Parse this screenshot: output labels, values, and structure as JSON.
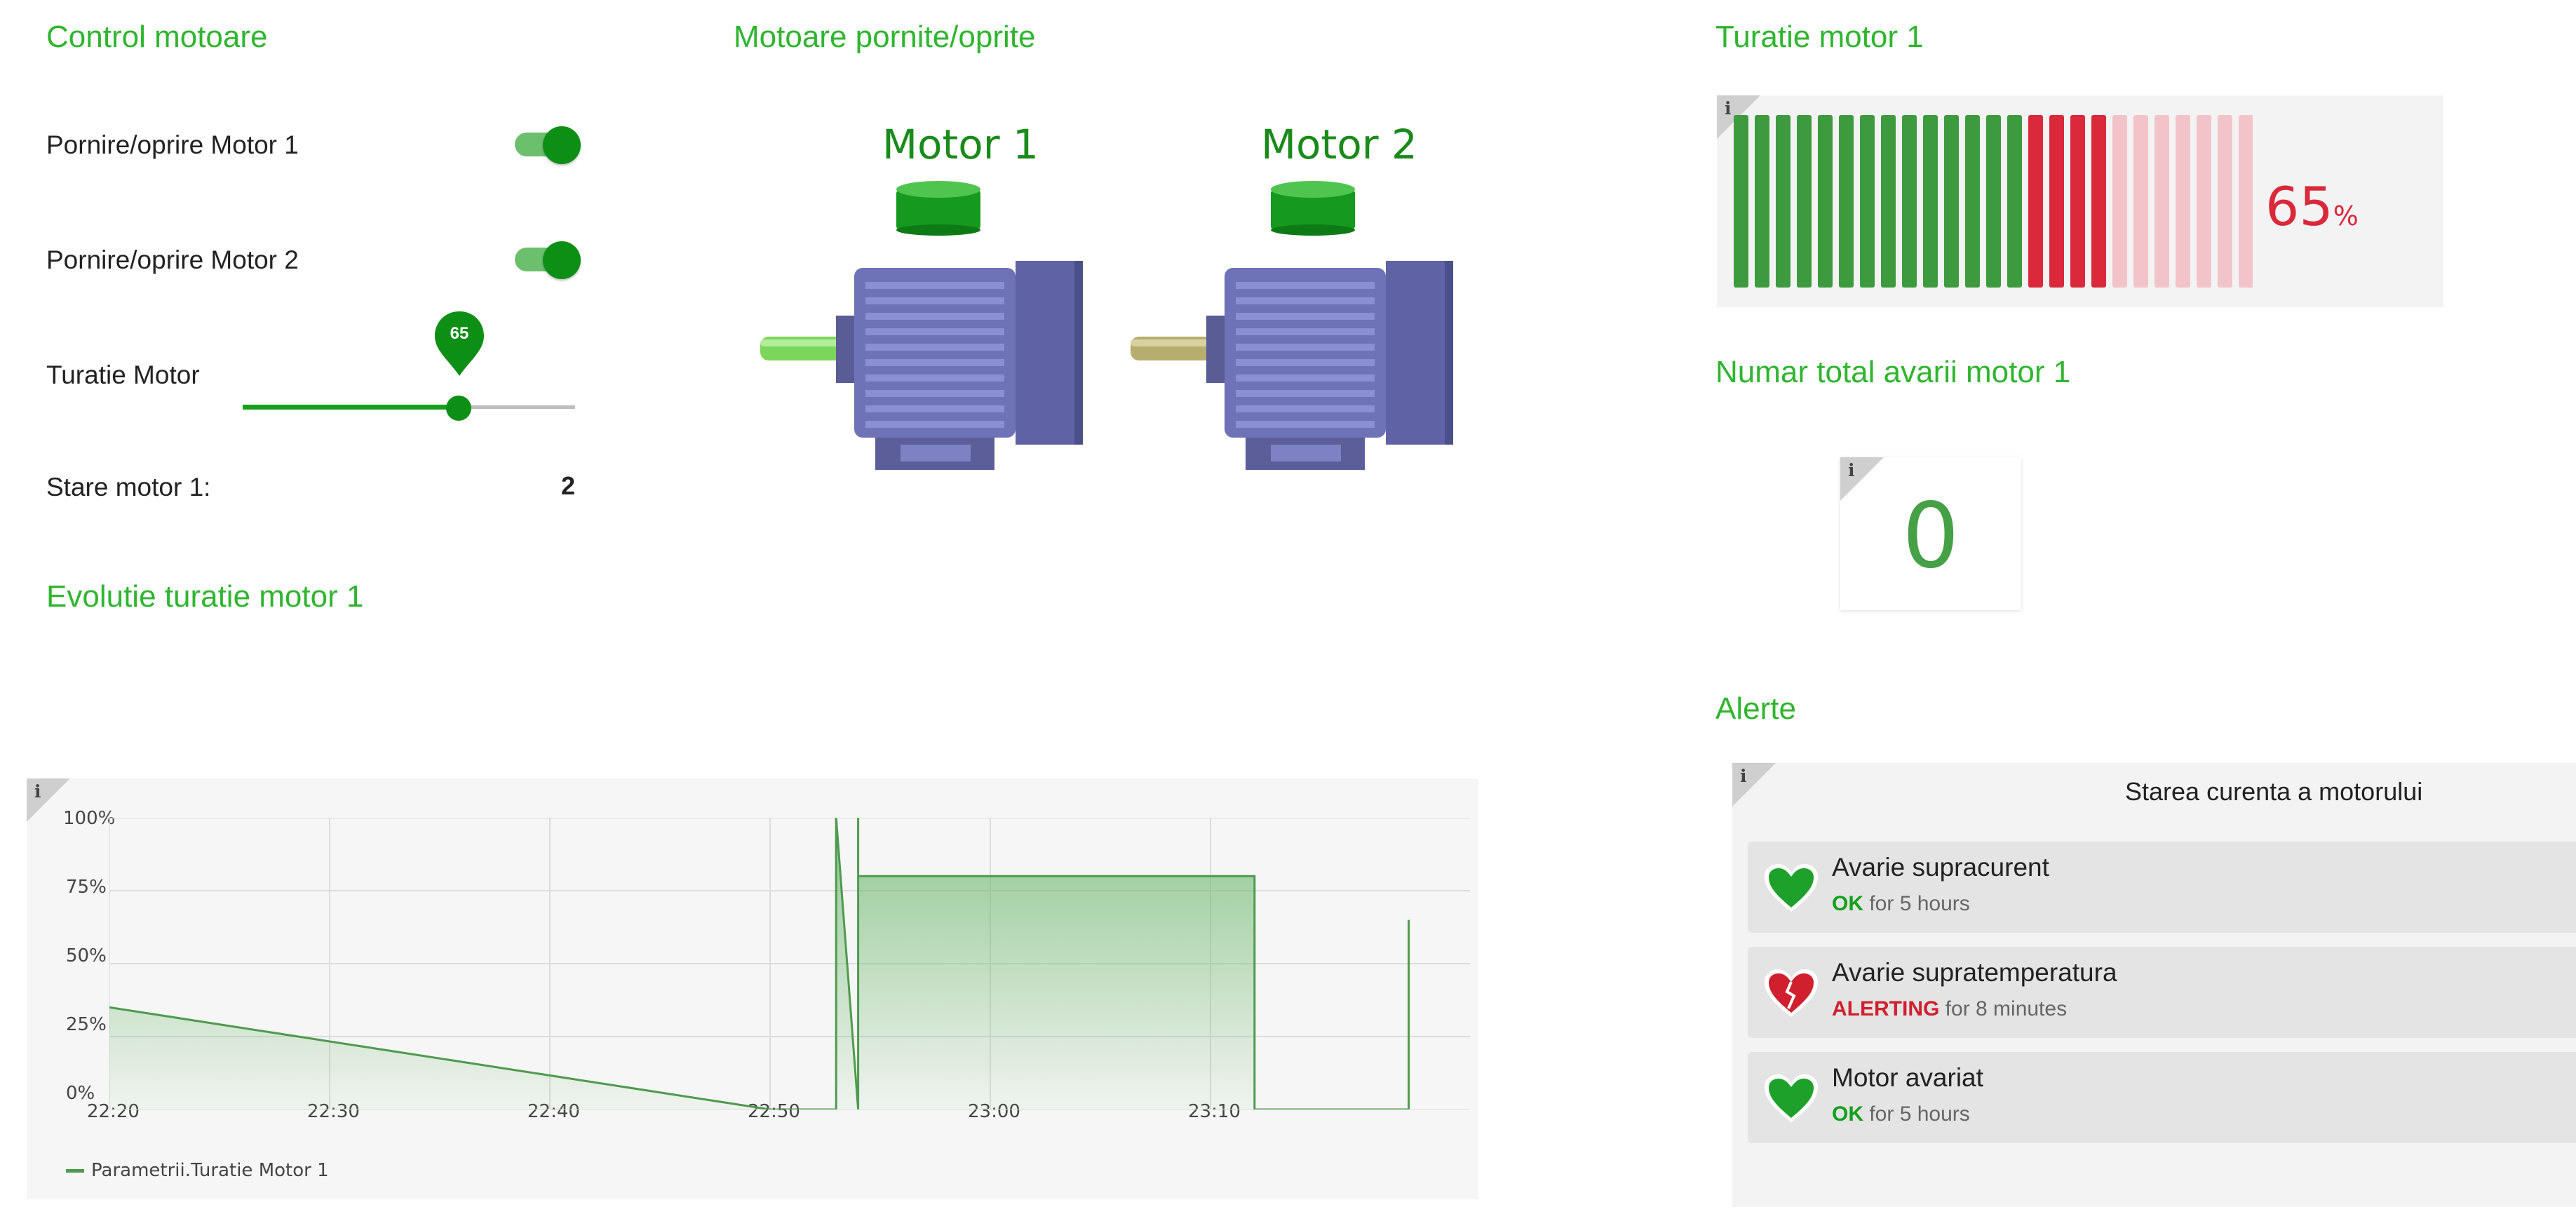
{
  "control": {
    "title": "Control motoare",
    "motor1_label": "Pornire/oprire Motor 1",
    "motor2_label": "Pornire/oprire Motor 2",
    "speed_label": "Turatie Motor",
    "speed_value": "65",
    "speed_fraction": 0.65,
    "state_label": "Stare motor 1:",
    "state_value": "2"
  },
  "motors": {
    "title": "Motoare pornite/oprite",
    "motor1_name": "Motor 1",
    "motor2_name": "Motor 2"
  },
  "gauge": {
    "title": "Turatie motor 1",
    "value": "65",
    "unit": "%",
    "green_segments": 14,
    "red_segments": 4,
    "empty_segments": 8
  },
  "faults": {
    "title": "Numar total avarii motor 1",
    "value": "0"
  },
  "graph": {
    "title": "Evolutie turatie motor 1",
    "y_ticks": [
      "0%",
      "25%",
      "50%",
      "75%",
      "100%"
    ],
    "x_ticks": [
      "22:20",
      "22:30",
      "22:40",
      "22:50",
      "23:00",
      "23:10"
    ],
    "legend": "Parametrii.Turatie Motor 1"
  },
  "chart_data": {
    "type": "area",
    "xlabel": "",
    "ylabel": "",
    "ylim": [
      0,
      100
    ],
    "series": [
      {
        "name": "Parametrii.Turatie Motor 1",
        "points": [
          [
            "22:20",
            35
          ],
          [
            "22:50",
            0
          ],
          [
            "22:53",
            0
          ],
          [
            "22:53",
            100
          ],
          [
            "22:54",
            0
          ],
          [
            "22:54",
            100
          ],
          [
            "22:54",
            80
          ],
          [
            "23:12",
            80
          ],
          [
            "23:12",
            0
          ],
          [
            "23:19",
            0
          ],
          [
            "23:19",
            65
          ]
        ]
      }
    ]
  },
  "alerts": {
    "title": "Alerte",
    "header": "Starea curenta a motorului",
    "items": [
      {
        "name": "Avarie supracurent",
        "state": "OK",
        "duration": "for 5 hours",
        "color": "#12a01c"
      },
      {
        "name": "Avarie supratemperatura",
        "state": "ALERTING",
        "duration": "for 8 minutes",
        "color": "#d0202e"
      },
      {
        "name": "Motor avariat",
        "state": "OK",
        "duration": "for 5 hours",
        "color": "#12a01c"
      }
    ]
  },
  "colors": {
    "accent": "#2fb52f",
    "toggle_on": "#0d8f16",
    "alert_red": "#d0202e",
    "gauge_green": "#3e9a3e",
    "gauge_red": "#d9293a"
  }
}
